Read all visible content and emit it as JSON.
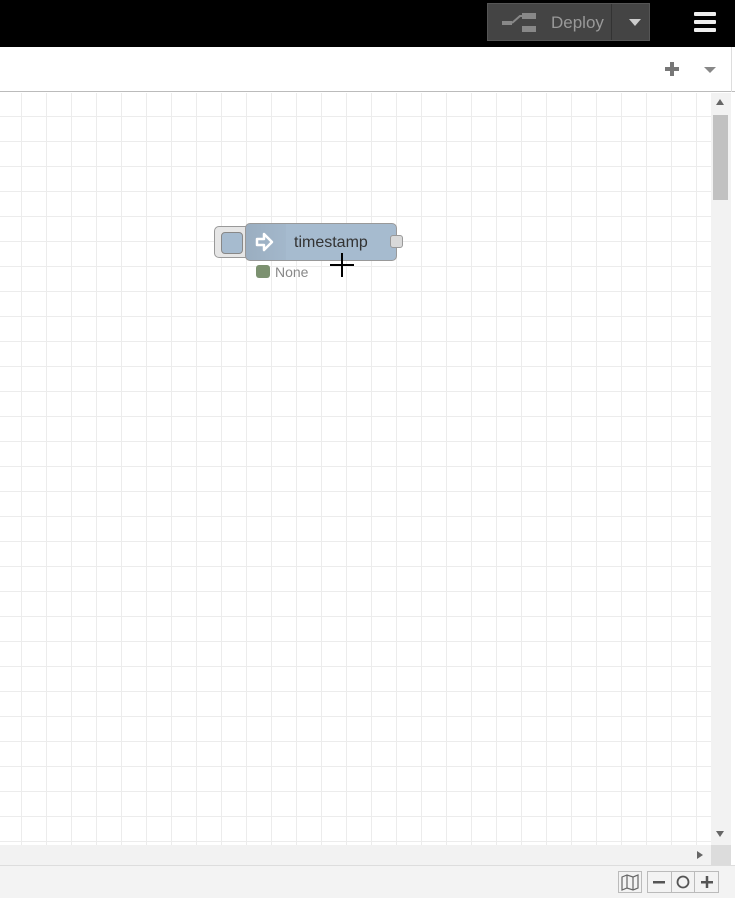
{
  "header": {
    "deploy_label": "Deploy",
    "deploy_icon": "deploy-flow-icon",
    "deploy_menu_icon": "caret-down-icon",
    "menu_icon": "hamburger-menu-icon"
  },
  "tabs_bar": {
    "add_icon": "plus-icon",
    "menu_icon": "caret-down-icon"
  },
  "workspace": {
    "nodes": [
      {
        "type": "inject",
        "label": "timestamp",
        "status": "None",
        "color": "#a6bbcf",
        "status_color": "#7c9170",
        "icon": "arrow-in-icon"
      }
    ]
  },
  "footer": {
    "navigator_icon": "map-icon",
    "zoom_out_icon": "minus-icon",
    "zoom_reset_icon": "circle-icon",
    "zoom_in_icon": "plus-icon"
  },
  "colors": {
    "header_bg": "#000000",
    "deploy_bg": "#444444",
    "grid_line": "#ececec"
  }
}
